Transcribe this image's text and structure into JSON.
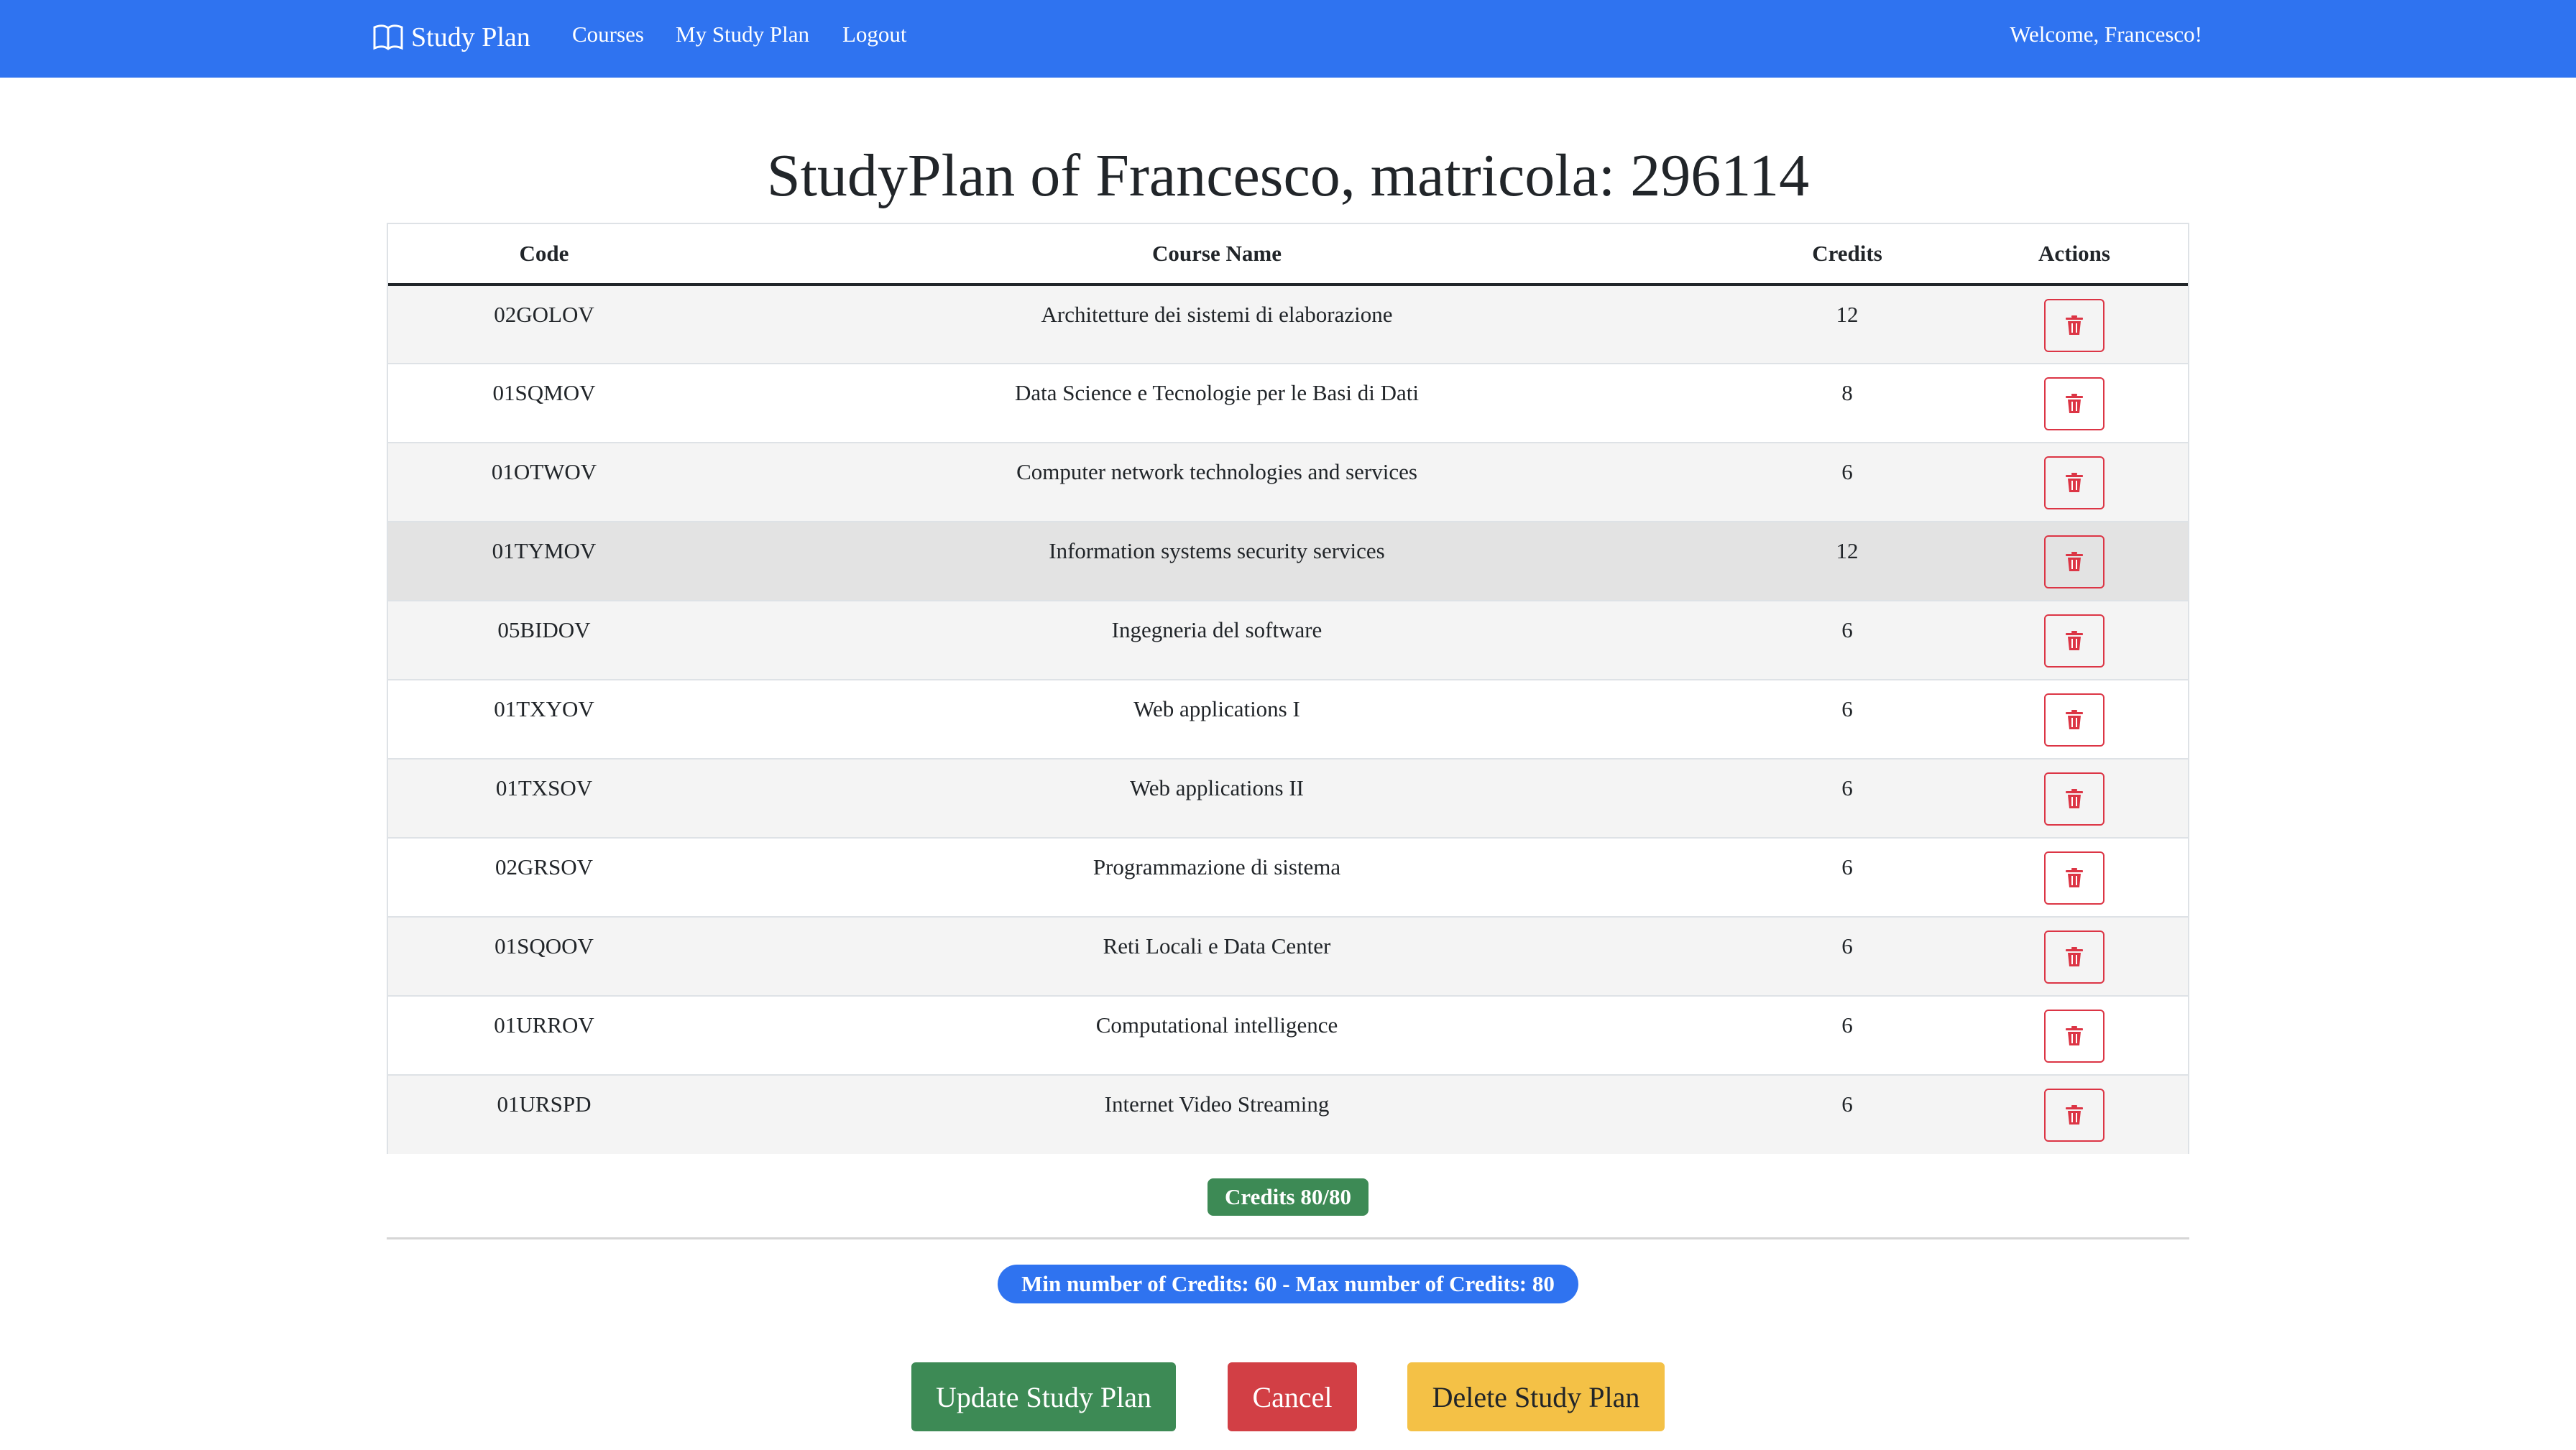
{
  "navbar": {
    "brand_label": "Study Plan",
    "brand_icon": "book-icon",
    "links": [
      {
        "label": "Courses"
      },
      {
        "label": "My Study Plan"
      },
      {
        "label": "Logout"
      }
    ],
    "welcome": "Welcome, Francesco!"
  },
  "page_title": "StudyPlan of Francesco, matricola: 296114",
  "table": {
    "headers": [
      "Code",
      "Course Name",
      "Credits",
      "Actions"
    ],
    "rows": [
      {
        "code": "02GOLOV",
        "name": "Architetture dei sistemi di elaborazione",
        "credits": "12"
      },
      {
        "code": "01SQMOV",
        "name": "Data Science e Tecnologie per le Basi di Dati",
        "credits": "8"
      },
      {
        "code": "01OTWOV",
        "name": "Computer network technologies and services",
        "credits": "6"
      },
      {
        "code": "01TYMOV",
        "name": "Information systems security services",
        "credits": "12"
      },
      {
        "code": "05BIDOV",
        "name": "Ingegneria del software",
        "credits": "6"
      },
      {
        "code": "01TXYOV",
        "name": "Web applications I",
        "credits": "6"
      },
      {
        "code": "01TXSOV",
        "name": "Web applications II",
        "credits": "6"
      },
      {
        "code": "02GRSOV",
        "name": "Programmazione di sistema",
        "credits": "6"
      },
      {
        "code": "01SQOOV",
        "name": "Reti Locali e Data Center",
        "credits": "6"
      },
      {
        "code": "01URROV",
        "name": "Computational intelligence",
        "credits": "6"
      },
      {
        "code": "01URSPD",
        "name": "Internet Video Streaming",
        "credits": "6"
      }
    ],
    "action_icon": "trash-icon"
  },
  "credits_badge": "Credits 80/80",
  "limits_badge": "Min number of Credits: 60 - Max number of Credits: 80",
  "buttons": {
    "update": "Update Study Plan",
    "cancel": "Cancel",
    "delete": "Delete Study Plan"
  },
  "colors": {
    "navbar": "#2f73f0",
    "success": "#3d8a55",
    "danger": "#d23f45",
    "warning": "#f4c146",
    "primary": "#2f73f0"
  }
}
